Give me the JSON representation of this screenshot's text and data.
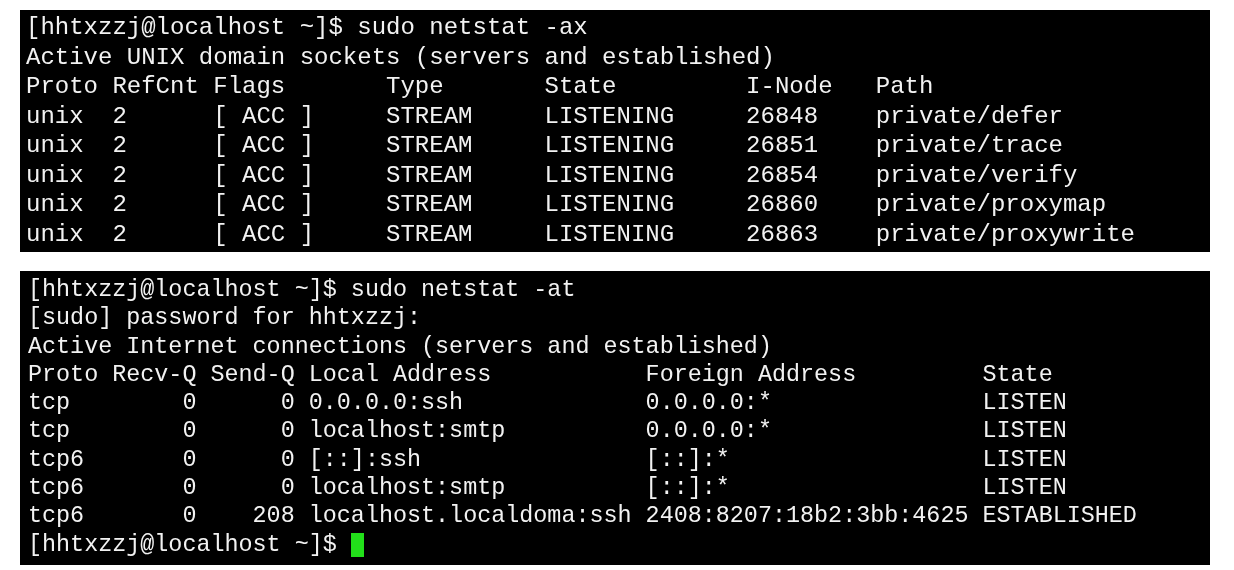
{
  "terminals": [
    {
      "lines": [
        "[hhtxzzj@localhost ~]$ sudo netstat -ax",
        "Active UNIX domain sockets (servers and established)",
        "Proto RefCnt Flags       Type       State         I-Node   Path",
        "unix  2      [ ACC ]     STREAM     LISTENING     26848    private/defer",
        "unix  2      [ ACC ]     STREAM     LISTENING     26851    private/trace",
        "unix  2      [ ACC ]     STREAM     LISTENING     26854    private/verify",
        "unix  2      [ ACC ]     STREAM     LISTENING     26860    private/proxymap",
        "unix  2      [ ACC ]     STREAM     LISTENING     26863    private/proxywrite"
      ],
      "cursor": false
    },
    {
      "lines": [
        "[hhtxzzj@localhost ~]$ sudo netstat -at",
        "[sudo] password for hhtxzzj:",
        "Active Internet connections (servers and established)",
        "Proto Recv-Q Send-Q Local Address           Foreign Address         State",
        "tcp        0      0 0.0.0.0:ssh             0.0.0.0:*               LISTEN",
        "tcp        0      0 localhost:smtp          0.0.0.0:*               LISTEN",
        "tcp6       0      0 [::]:ssh                [::]:*                  LISTEN",
        "tcp6       0      0 localhost:smtp          [::]:*                  LISTEN",
        "tcp6       0    208 localhost.localdoma:ssh 2408:8207:18b2:3bb:4625 ESTABLISHED",
        "[hhtxzzj@localhost ~]$ "
      ],
      "cursor": true
    }
  ]
}
